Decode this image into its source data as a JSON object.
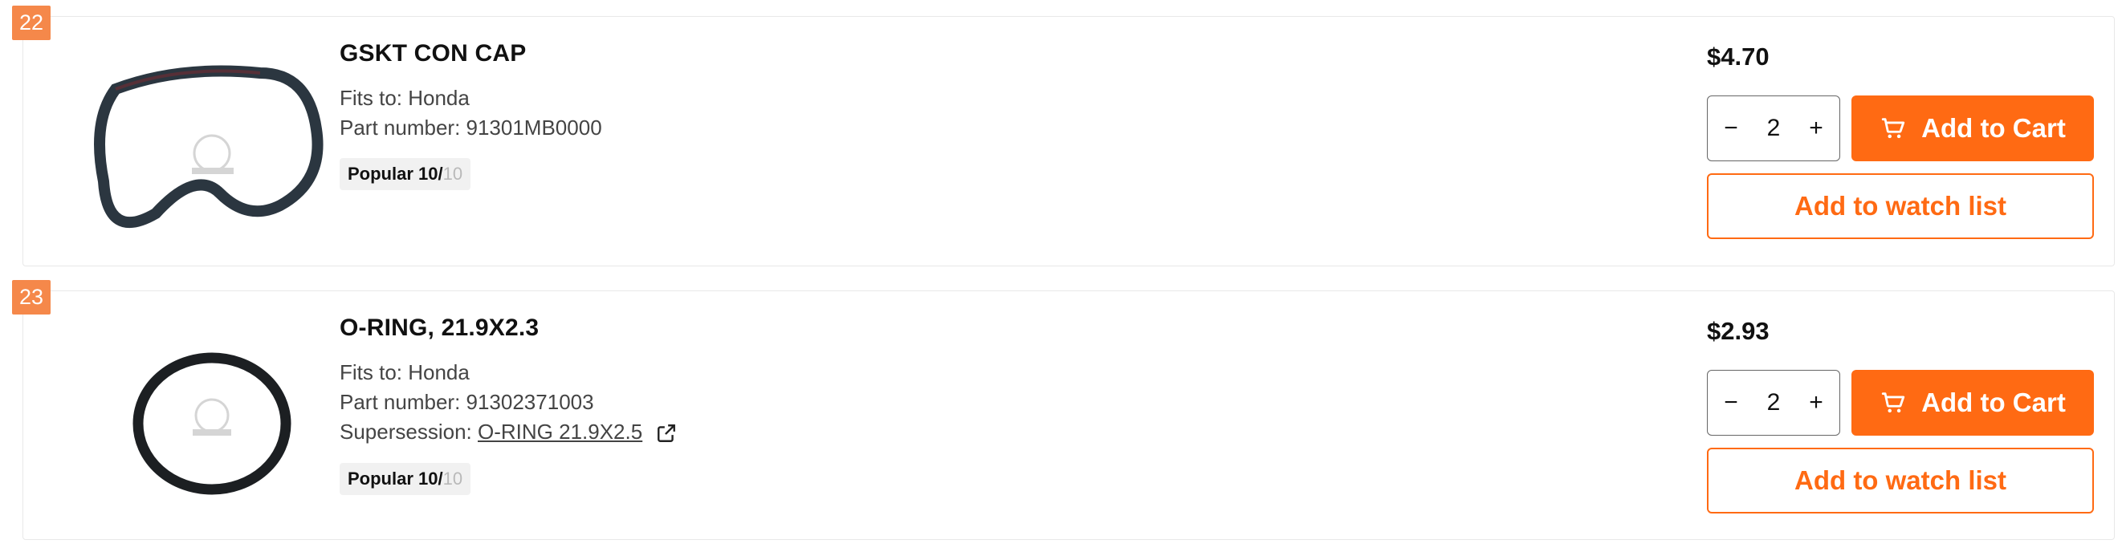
{
  "brand_color": "#ff6a13",
  "badge_color": "#f5884a",
  "items": [
    {
      "index": "22",
      "image_caption": "GSKT CON CAP | parts: 91301MB0000",
      "title": "GSKT CON CAP",
      "fits_to": "Fits to: Honda",
      "part_number": "Part number: 91301MB0000",
      "popular_label": "Popular 10/",
      "popular_max": "10",
      "price": "$4.70",
      "quantity": "2",
      "add_to_cart": "Add to Cart",
      "watch_list": "Add to watch list"
    },
    {
      "index": "23",
      "image_caption": "O-RING 21.9X2.3 | parts: 91302371003",
      "title": "O-RING, 21.9X2.3",
      "fits_to": "Fits to: Honda",
      "part_number": "Part number: 91302371003",
      "supersession_label": "Supersession:",
      "supersession_link": "O-RING 21.9X2.5",
      "popular_label": "Popular 10/",
      "popular_max": "10",
      "price": "$2.93",
      "quantity": "2",
      "add_to_cart": "Add to Cart",
      "watch_list": "Add to watch list"
    }
  ],
  "icons": {
    "cart": "cart-icon",
    "minus": "minus-icon",
    "plus": "plus-icon",
    "external_link": "external-link-icon"
  }
}
